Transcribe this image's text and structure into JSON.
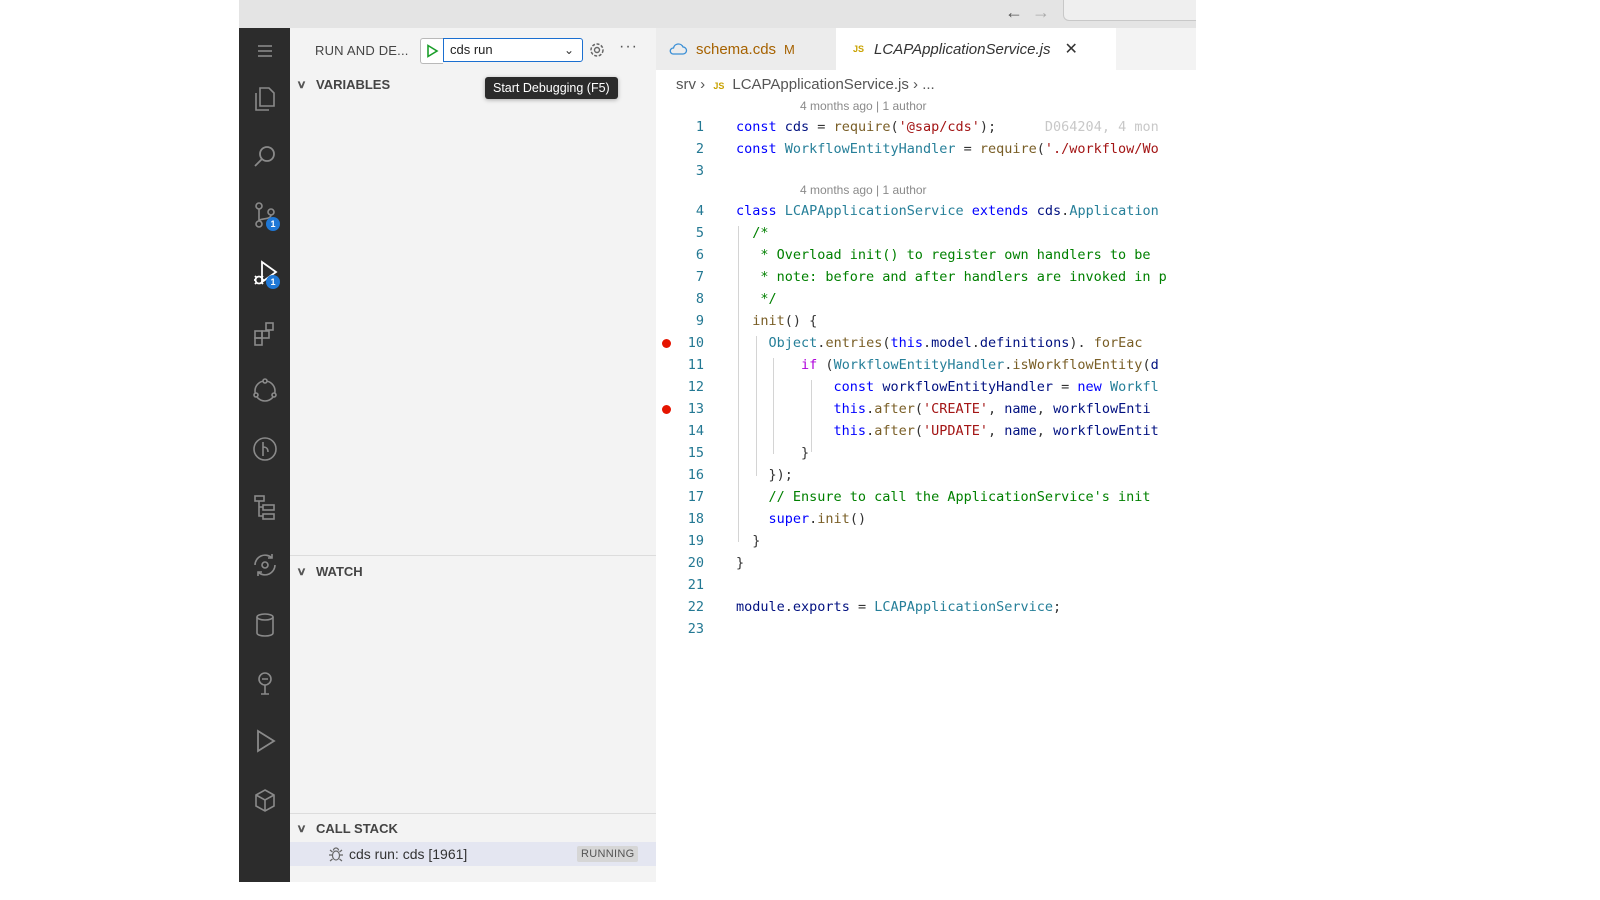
{
  "browser": {
    "back_glyph": "←",
    "forward_glyph": "→"
  },
  "activity_bar": {
    "items": [
      {
        "name": "menu-icon"
      },
      {
        "name": "explorer-icon"
      },
      {
        "name": "search-icon"
      },
      {
        "name": "source-control-icon",
        "badge": "1"
      },
      {
        "name": "run-debug-icon",
        "badge": "1",
        "active": true
      },
      {
        "name": "extensions-icon"
      },
      {
        "name": "remote-explorer-icon"
      },
      {
        "name": "git-graph-icon"
      },
      {
        "name": "tree-view-icon"
      },
      {
        "name": "sync-icon"
      },
      {
        "name": "database-icon"
      },
      {
        "name": "plug-icon"
      },
      {
        "name": "run-icon"
      },
      {
        "name": "cube-icon"
      }
    ]
  },
  "run_panel": {
    "title": "RUN AND DE...",
    "config_selected": "cds run",
    "dropdown_glyph": "⌄",
    "more_glyph": "···",
    "tooltip": "Start Debugging (F5)",
    "sections": {
      "variables": "VARIABLES",
      "watch": "WATCH",
      "call_stack": "CALL STACK"
    },
    "call_stack": {
      "label": "cds run: cds [1961]",
      "status": "RUNNING"
    }
  },
  "tabs": [
    {
      "label": "schema.cds",
      "modified": "M"
    },
    {
      "label": "LCAPApplicationService.js",
      "badge": "JS",
      "close": "✕"
    }
  ],
  "breadcrumb": {
    "folder": "srv",
    "sep": "›",
    "badge": "JS",
    "file": "LCAPApplicationService.js",
    "tail": "..."
  },
  "codelens": [
    "4 months ago | 1 author",
    "4 months ago | 1 author"
  ],
  "blame_inline": "D064204, 4 mon",
  "breakpoint_lines": [
    10,
    13
  ],
  "code_lines": [
    {
      "n": "1",
      "text": "const cds = require('@sap/cds');"
    },
    {
      "n": "2",
      "text": "const WorkflowEntityHandler = require('./workflow/Wo"
    },
    {
      "n": "3",
      "text": ""
    },
    {
      "n": "4",
      "text": "class LCAPApplicationService extends cds.Application"
    },
    {
      "n": "5",
      "text": "  /*"
    },
    {
      "n": "6",
      "text": "   * Overload init() to register own handlers to be"
    },
    {
      "n": "7",
      "text": "   * note: before and after handlers are invoked in p"
    },
    {
      "n": "8",
      "text": "   */"
    },
    {
      "n": "9",
      "text": "  init() {"
    },
    {
      "n": "10",
      "text": "    Object.entries(this.model.definitions). forEac"
    },
    {
      "n": "11",
      "text": "        if (WorkflowEntityHandler.isWorkflowEntity(d"
    },
    {
      "n": "12",
      "text": "            const workflowEntityHandler = new Workfl"
    },
    {
      "n": "13",
      "text": "            this.after('CREATE', name, workflowEnti"
    },
    {
      "n": "14",
      "text": "            this.after('UPDATE', name, workflowEntit"
    },
    {
      "n": "15",
      "text": "        }"
    },
    {
      "n": "16",
      "text": "    });"
    },
    {
      "n": "17",
      "text": "    // Ensure to call the ApplicationService's init "
    },
    {
      "n": "18",
      "text": "    super.init()"
    },
    {
      "n": "19",
      "text": "  }"
    },
    {
      "n": "20",
      "text": "}"
    },
    {
      "n": "21",
      "text": ""
    },
    {
      "n": "22",
      "text": "module.exports = LCAPApplicationService;"
    },
    {
      "n": "23",
      "text": ""
    }
  ]
}
